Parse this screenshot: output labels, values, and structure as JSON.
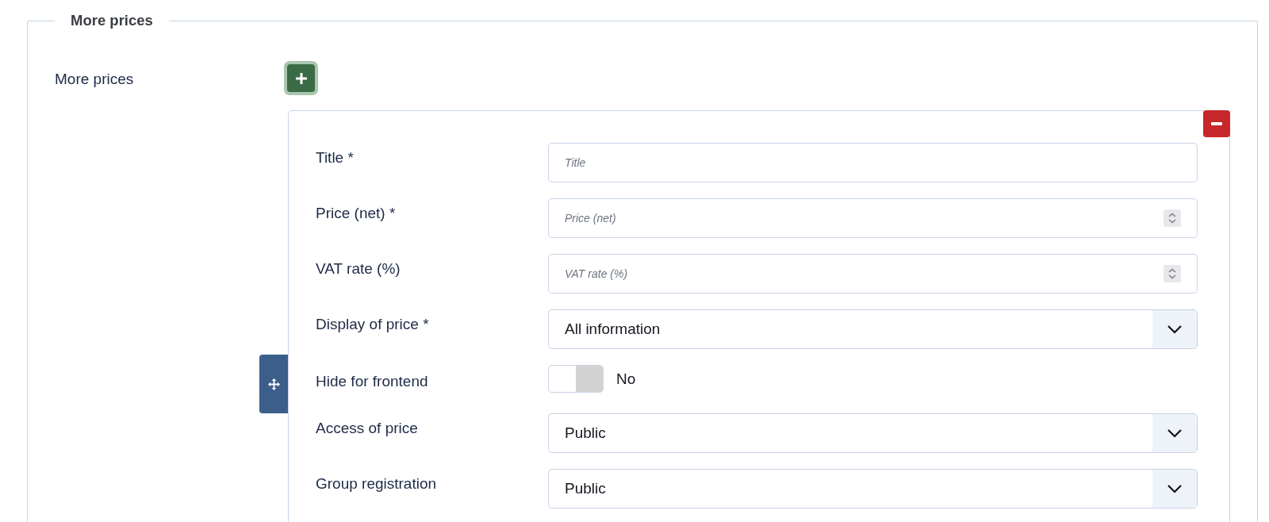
{
  "section": {
    "legend": "More prices",
    "label": "More prices",
    "items": [
      {
        "fields": [
          {
            "kind": "text",
            "label": "Title *",
            "placeholder": "Title"
          },
          {
            "kind": "number",
            "label": "Price (net) *",
            "placeholder": "Price (net)"
          },
          {
            "kind": "number",
            "label": "VAT rate (%)",
            "placeholder": "VAT rate (%)"
          },
          {
            "kind": "select",
            "label": "Display of price *",
            "value": "All information"
          },
          {
            "kind": "toggle",
            "label": "Hide for frontend",
            "on": false,
            "state_label": "No"
          },
          {
            "kind": "select",
            "label": "Access of price",
            "value": "Public"
          },
          {
            "kind": "select",
            "label": "Group registration",
            "value": "Public"
          }
        ]
      }
    ]
  }
}
